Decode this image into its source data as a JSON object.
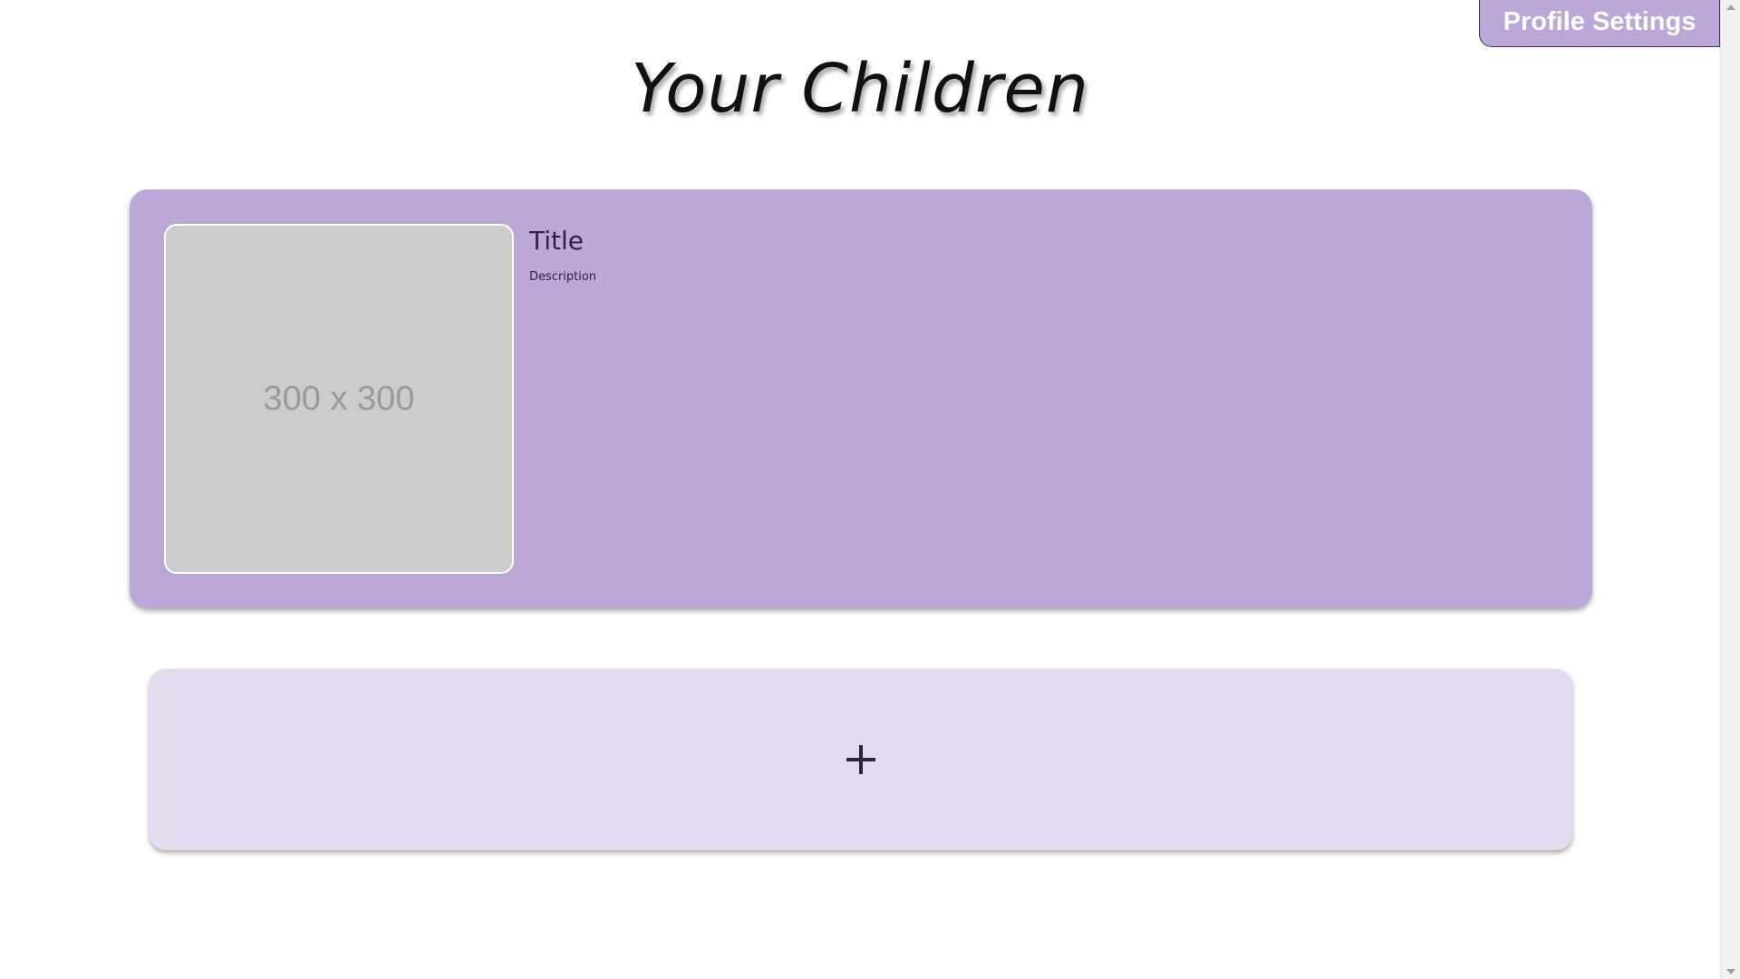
{
  "header": {
    "profile_settings_label": "Profile Settings"
  },
  "page": {
    "title": "Your Children"
  },
  "children": [
    {
      "photo_placeholder": "300 x 300",
      "title": "Title",
      "description": "Description"
    }
  ],
  "add_child": {
    "icon": "plus-icon"
  },
  "colors": {
    "accent": "#bba8d8",
    "accent_light": "#e3dbf0",
    "placeholder_bg": "#cccccc",
    "text_dark": "#2b2540"
  }
}
